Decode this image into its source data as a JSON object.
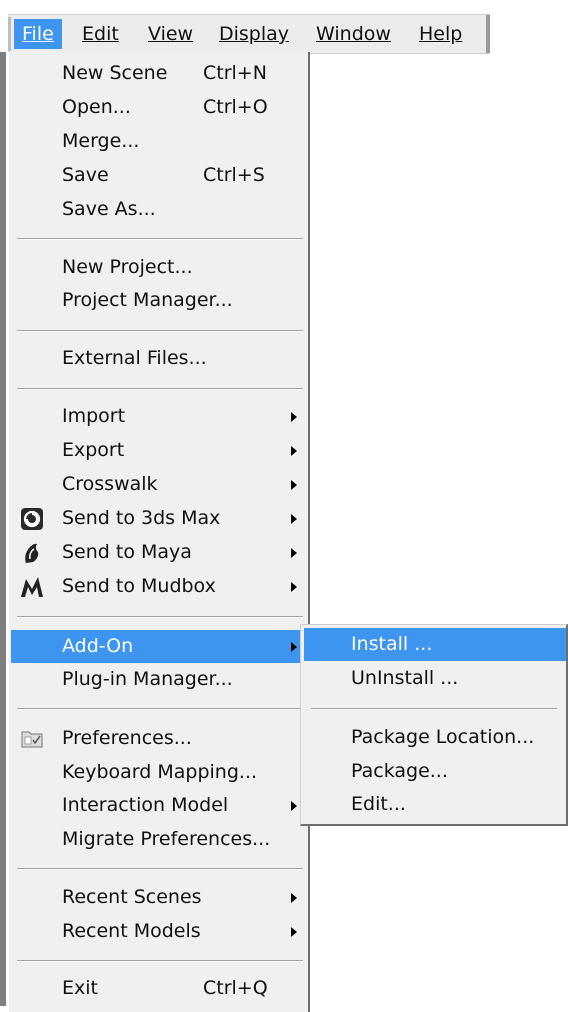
{
  "menubar": {
    "items": [
      {
        "label": "File",
        "active": true
      },
      {
        "label": "Edit"
      },
      {
        "label": "View"
      },
      {
        "label": "Display"
      },
      {
        "label": "Window"
      },
      {
        "label": "Help"
      }
    ]
  },
  "file_menu": {
    "items": [
      {
        "label": "New Scene",
        "accel": "Ctrl+N"
      },
      {
        "label": "Open...",
        "accel": "Ctrl+O"
      },
      {
        "label": "Merge..."
      },
      {
        "label": "Save",
        "accel": "Ctrl+S"
      },
      {
        "label": "Save As..."
      },
      {
        "label": "New Project..."
      },
      {
        "label": "Project Manager..."
      },
      {
        "label": "External Files..."
      },
      {
        "label": "Import",
        "submenu": true
      },
      {
        "label": "Export",
        "submenu": true
      },
      {
        "label": "Crosswalk",
        "submenu": true
      },
      {
        "label": "Send to 3ds Max",
        "submenu": true,
        "icon": "3ds-max-icon"
      },
      {
        "label": "Send to Maya",
        "submenu": true,
        "icon": "maya-icon"
      },
      {
        "label": "Send to Mudbox",
        "submenu": true,
        "icon": "mudbox-icon"
      },
      {
        "label": "Add-On",
        "submenu": true,
        "highlighted": true
      },
      {
        "label": "Plug-in Manager..."
      },
      {
        "label": "Preferences...",
        "icon": "preferences-icon"
      },
      {
        "label": "Keyboard Mapping..."
      },
      {
        "label": "Interaction Model",
        "submenu": true
      },
      {
        "label": "Migrate Preferences..."
      },
      {
        "label": "Recent Scenes",
        "submenu": true
      },
      {
        "label": "Recent Models",
        "submenu": true
      },
      {
        "label": "Exit",
        "accel": "Ctrl+Q"
      }
    ]
  },
  "addon_submenu": {
    "items": [
      {
        "label": "Install ...",
        "highlighted": true
      },
      {
        "label": "UnInstall ..."
      },
      {
        "label": "Package Location..."
      },
      {
        "label": "Package..."
      },
      {
        "label": "Edit..."
      }
    ]
  },
  "colors": {
    "highlight": "#3d95ef",
    "menu_bg": "#f0f0f0",
    "menubar_bg": "#ececec"
  }
}
